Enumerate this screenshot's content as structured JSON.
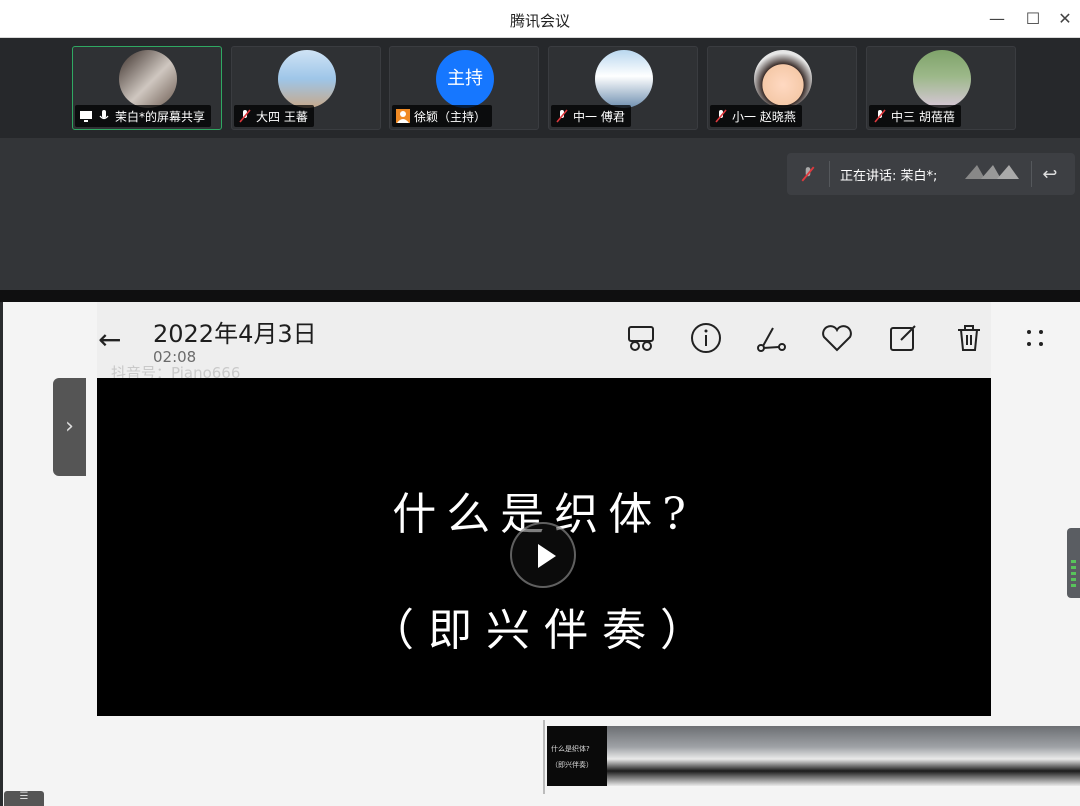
{
  "window": {
    "title": "腾讯会议",
    "minimize_glyph": "—",
    "maximize_glyph": "☐",
    "close_glyph": "✕"
  },
  "participants": [
    {
      "name": "茉白*的屏幕共享",
      "role": "screen-share",
      "active": true
    },
    {
      "name": "大四 王蕃",
      "role": "muted"
    },
    {
      "name": "徐颖（主持）",
      "role": "host",
      "avatar_text": "主持"
    },
    {
      "name": "中一 傅君",
      "role": "muted"
    },
    {
      "name": "小一 赵晓燕",
      "role": "muted"
    },
    {
      "name": "中三 胡蓓蓓",
      "role": "muted"
    }
  ],
  "speaking": {
    "label": "正在讲话: 茉白*;"
  },
  "viewer": {
    "date": "2022年4月3日",
    "time": "02:08",
    "watermark": "抖音号：Piano666",
    "subtitle_line1": "什么是织体?",
    "subtitle_line2": "（即兴伴奏）",
    "toolbar_icons": [
      "crop-icon",
      "info-icon",
      "share-icon",
      "heart-icon",
      "edit-icon",
      "trash-icon",
      "more-icon"
    ]
  },
  "timeline": {
    "first_frame_line1": "什么是织体?",
    "first_frame_line2": "（即兴伴奏）"
  },
  "colors": {
    "active_border": "#2fa862",
    "host_blue": "#1677ff",
    "app_bg": "#2a2c2e"
  }
}
